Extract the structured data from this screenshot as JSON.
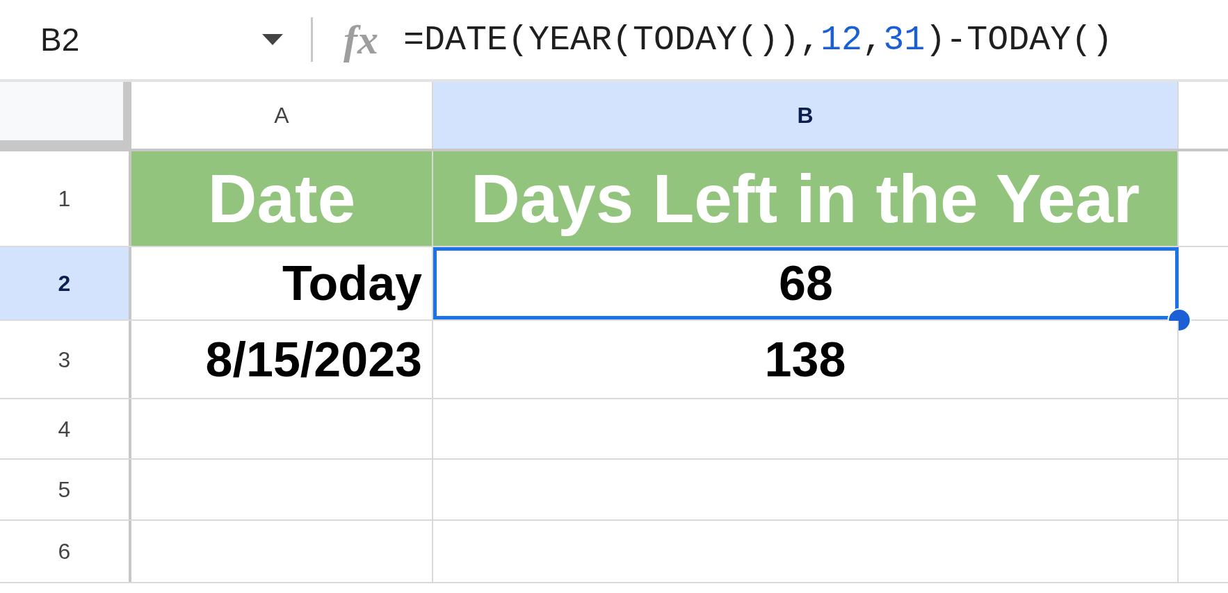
{
  "name_box": "B2",
  "formula_icon": "fx",
  "formula": [
    {
      "kind": "text",
      "text": "=DATE(YEAR(TODAY()),"
    },
    {
      "kind": "number",
      "text": "12"
    },
    {
      "kind": "text",
      "text": ","
    },
    {
      "kind": "number",
      "text": "31"
    },
    {
      "kind": "text",
      "text": ")-TODAY()"
    }
  ],
  "columns": [
    {
      "label": "A",
      "selected": false
    },
    {
      "label": "B",
      "selected": true
    }
  ],
  "rows": [
    {
      "label": "1",
      "selected": false,
      "kind": "header",
      "cells": [
        {
          "text": "Date",
          "selected": false
        },
        {
          "text": "Days Left in the Year",
          "selected": false
        }
      ]
    },
    {
      "label": "2",
      "selected": true,
      "kind": "data",
      "cells": [
        {
          "text": "Today",
          "selected": false
        },
        {
          "text": "68",
          "selected": true
        }
      ]
    },
    {
      "label": "3",
      "selected": false,
      "kind": "data",
      "cells": [
        {
          "text": "8/15/2023",
          "selected": false
        },
        {
          "text": "138",
          "selected": false
        }
      ]
    },
    {
      "label": "4",
      "selected": false,
      "kind": "empty"
    },
    {
      "label": "5",
      "selected": false,
      "kind": "empty"
    },
    {
      "label": "6",
      "selected": false,
      "kind": "empty"
    }
  ]
}
